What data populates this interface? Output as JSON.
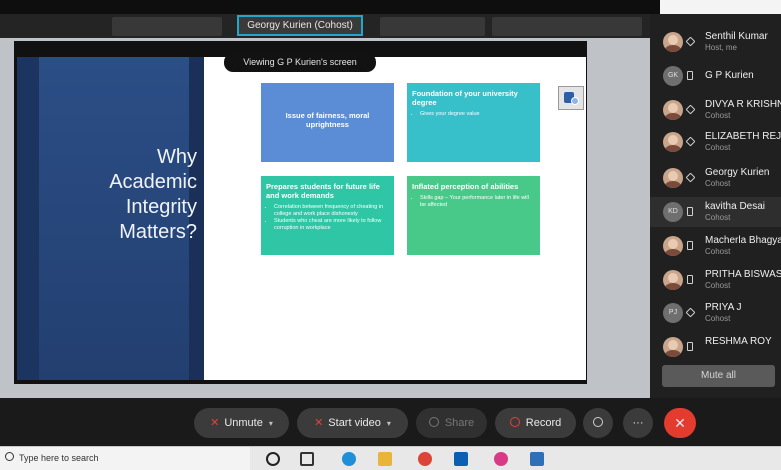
{
  "meeting": {
    "active_speaker_tile": "Georgy Kurien (Cohost)",
    "viewing_label": "Viewing G P Kurien's screen"
  },
  "slide": {
    "title_lines": [
      "Why",
      "Academic",
      "Integrity",
      "Matters?"
    ],
    "boxes": [
      {
        "title": "Issue of fairness, moral uprightness",
        "bullets": [],
        "color": "#5b8dd6"
      },
      {
        "title": "Foundation of your university degree",
        "bullets": [
          "Gives your degree value"
        ],
        "color": "#37bfca"
      },
      {
        "title": "Prepares students for future life and work demands",
        "bullets": [
          "Correlation between frequency of cheating in college and work place dishonesty",
          "Students who cheat are more likely to follow corruption in workplace"
        ],
        "color": "#2fc6a6"
      },
      {
        "title": "Inflated perception of abilities",
        "bullets": [
          "Skills gap – Your performance later in life will be affected"
        ],
        "color": "#48c98a"
      }
    ]
  },
  "participants": [
    {
      "name": "Senthil Kumar",
      "role": "Host, me",
      "avatar": "photo",
      "device": "diamond"
    },
    {
      "name": "G P Kurien",
      "role": "",
      "avatar": "GK",
      "device": "phone"
    },
    {
      "name": "DIVYA R KRISHNAN",
      "role": "Cohost",
      "avatar": "photo",
      "device": "diamond"
    },
    {
      "name": "ELIZABETH REJI",
      "role": "Cohost",
      "avatar": "photo",
      "device": "diamond"
    },
    {
      "name": "Georgy Kurien",
      "role": "Cohost",
      "avatar": "photo",
      "device": "diamond"
    },
    {
      "name": "kavitha Desai",
      "role": "Cohost",
      "avatar": "KD",
      "device": "phone"
    },
    {
      "name": "Macherla Bhagya",
      "role": "Cohost",
      "avatar": "photo",
      "device": "phone"
    },
    {
      "name": "PRITHA BISWAS",
      "role": "Cohost",
      "avatar": "photo",
      "device": "phone"
    },
    {
      "name": "PRIYA J",
      "role": "Cohost",
      "avatar": "PJ",
      "device": "diamond"
    },
    {
      "name": "RESHMA ROY",
      "role": "",
      "avatar": "photo",
      "device": "phone"
    }
  ],
  "panel": {
    "mute_all_label": "Mute all"
  },
  "controls": {
    "unmute_label": "Unmute",
    "video_label": "Start video",
    "share_label": "Share",
    "record_label": "Record",
    "more_label": "···",
    "end_label": "✕"
  },
  "taskbar": {
    "search_placeholder": "Type here to search"
  },
  "colors": {
    "accent": "#23a6c9",
    "end_call": "#e33b2e"
  }
}
